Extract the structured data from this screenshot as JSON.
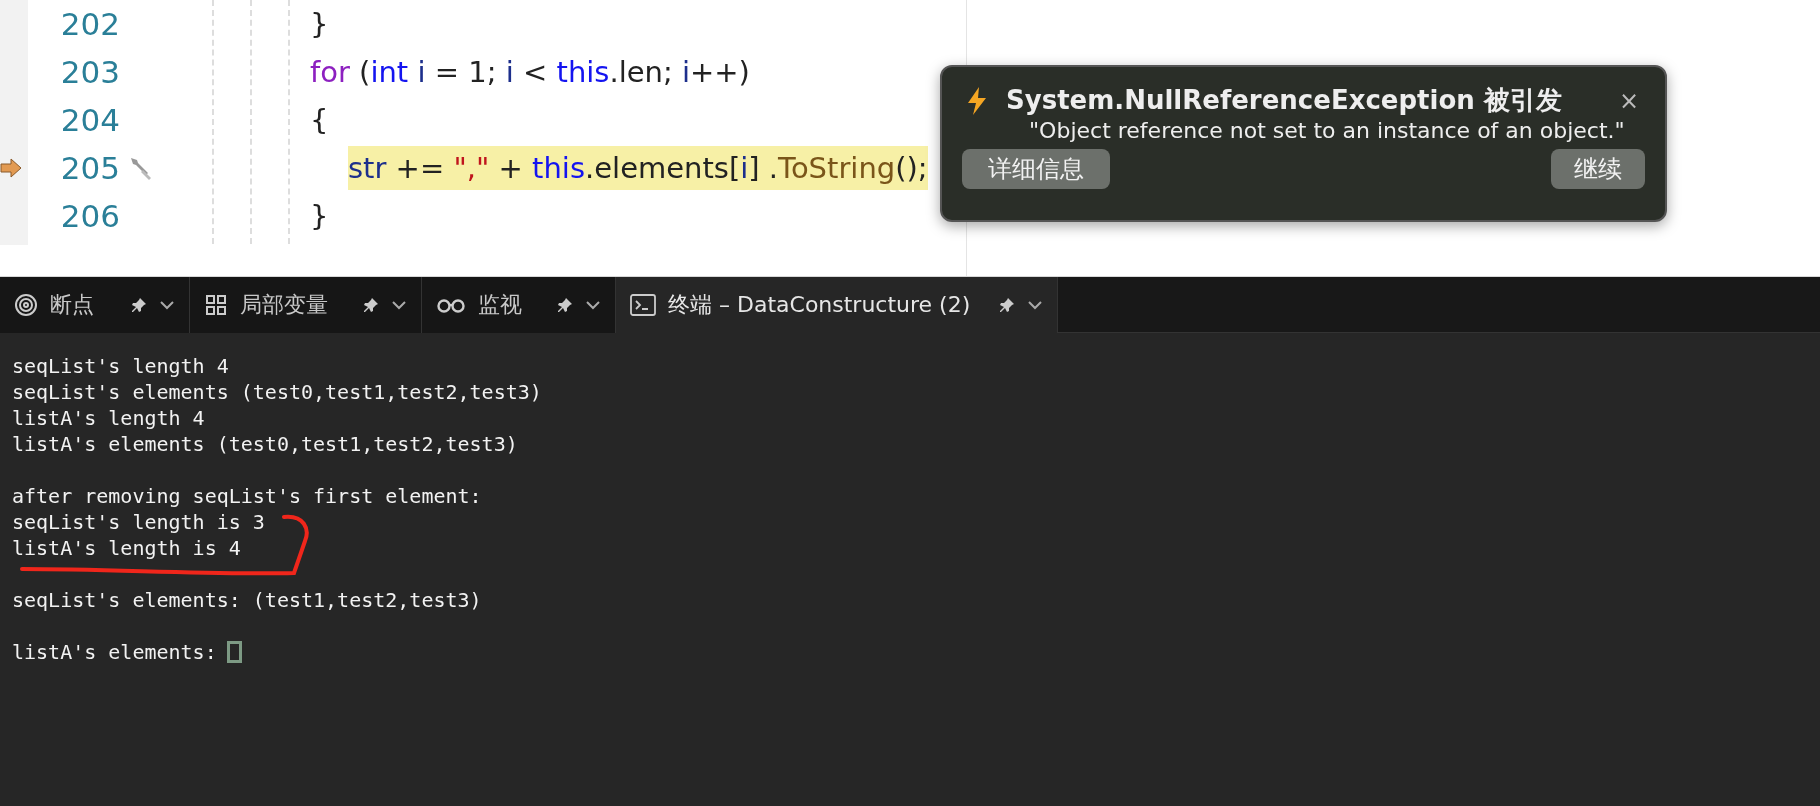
{
  "editor": {
    "lines": [
      {
        "number": "202",
        "current": false,
        "tokens": [
          {
            "kind": "plain",
            "text": "}"
          }
        ]
      },
      {
        "number": "203",
        "current": false,
        "tokens": [
          {
            "kind": "keyword",
            "text": "for"
          },
          {
            "kind": "plain",
            "text": " ("
          },
          {
            "kind": "type",
            "text": "int"
          },
          {
            "kind": "variable",
            "text": " i"
          },
          {
            "kind": "plain",
            "text": " = 1; "
          },
          {
            "kind": "variable",
            "text": "i"
          },
          {
            "kind": "plain",
            "text": " < "
          },
          {
            "kind": "type",
            "text": "this"
          },
          {
            "kind": "plain",
            "text": ".len; "
          },
          {
            "kind": "variable",
            "text": "i"
          },
          {
            "kind": "plain",
            "text": "++)"
          }
        ]
      },
      {
        "number": "204",
        "current": false,
        "tokens": [
          {
            "kind": "plain",
            "text": "{"
          }
        ],
        "children": [
          {
            "number": "205",
            "current": true,
            "tokens": [
              {
                "kind": "variable",
                "text": "str"
              },
              {
                "kind": "plain",
                "text": " += "
              },
              {
                "kind": "string",
                "text": "\",\""
              },
              {
                "kind": "plain",
                "text": " + "
              },
              {
                "kind": "type",
                "text": "this"
              },
              {
                "kind": "plain",
                "text": ".elements["
              },
              {
                "kind": "variable",
                "text": "i"
              },
              {
                "kind": "plain",
                "text": "] ."
              },
              {
                "kind": "method",
                "text": "ToString"
              },
              {
                "kind": "plain",
                "text": "();"
              }
            ]
          }
        ]
      },
      {
        "number": "206",
        "current": false,
        "tokens": [
          {
            "kind": "plain",
            "text": "}"
          }
        ]
      }
    ]
  },
  "exception_popup": {
    "title": "System.NullReferenceException 被引发",
    "close": "×",
    "message": "\"Object reference not set to an instance of an object.\"",
    "buttons": [
      "详细信息",
      "继续"
    ]
  },
  "panel_tabs": [
    {
      "kind": "breakpoints",
      "label": "断点",
      "selected": false
    },
    {
      "kind": "locals",
      "label": "局部变量",
      "selected": false
    },
    {
      "kind": "watch",
      "label": "监视",
      "selected": false
    },
    {
      "kind": "terminal",
      "label": "终端 – DataConstructure (2)",
      "selected": true
    }
  ],
  "terminal": {
    "blocks": [
      [
        "seqList's length 4",
        "seqList's elements (test0,test1,test2,test3)",
        "listA's length 4",
        "listA's elements (test0,test1,test2,test3)"
      ],
      [
        "after removing seqList's first element:",
        "seqList's length is 3",
        "listA's length is 4"
      ],
      [
        "seqList's elements: (test1,test2,test3)"
      ],
      [
        "listA's elements:"
      ]
    ]
  }
}
